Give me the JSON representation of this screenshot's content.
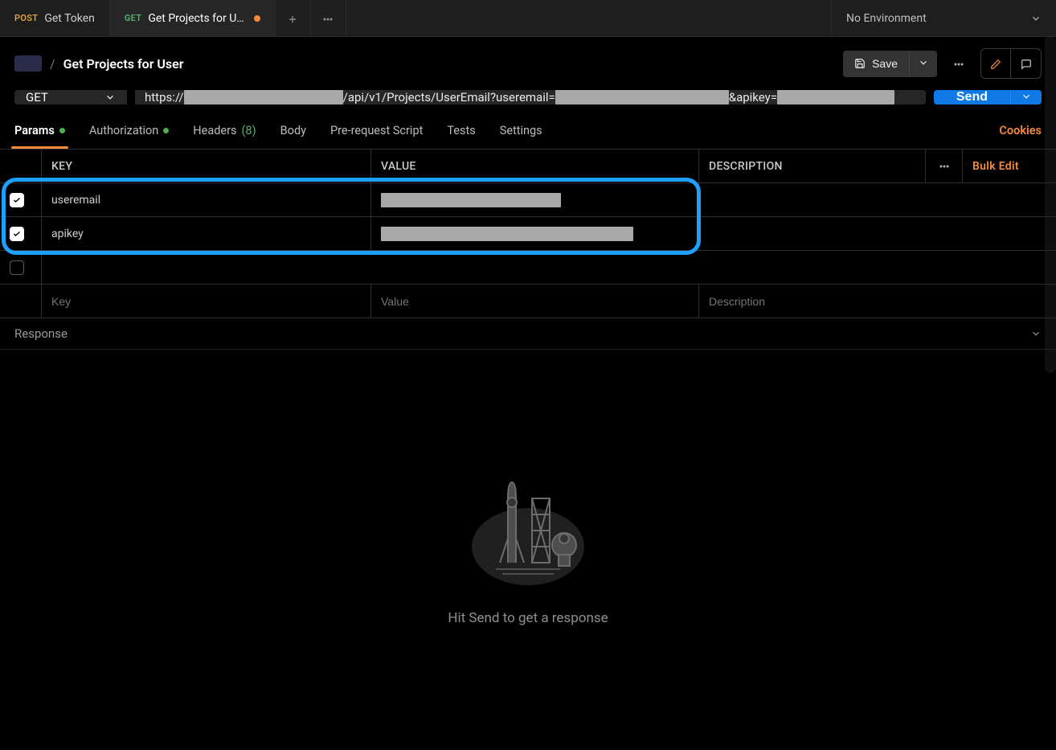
{
  "tabs": [
    {
      "method": "POST",
      "method_class": "method-post",
      "title": "Get Token",
      "active": false,
      "unsaved": false
    },
    {
      "method": "GET",
      "method_class": "method-get",
      "title": "Get Projects for U…",
      "active": true,
      "unsaved": true
    }
  ],
  "environment": {
    "label": "No Environment"
  },
  "breadcrumb": {
    "title": "Get Projects for User",
    "separator": "/"
  },
  "actions": {
    "save_label": "Save"
  },
  "request": {
    "method": "GET",
    "url_parts": {
      "p1": "https://",
      "p2": "/api/v1/Projects/UserEmail?useremail=",
      "p3": "&apikey="
    },
    "send_label": "Send"
  },
  "req_tabs": {
    "params": "Params",
    "auth": "Authorization",
    "headers": "Headers",
    "headers_count": "(8)",
    "body": "Body",
    "prescript": "Pre-request Script",
    "tests": "Tests",
    "settings": "Settings",
    "cookies": "Cookies"
  },
  "params_table": {
    "columns": {
      "key": "KEY",
      "value": "VALUE",
      "desc": "DESCRIPTION",
      "bulk": "Bulk Edit"
    },
    "rows": [
      {
        "checked": true,
        "key": "useremail",
        "value_redact_width": 224
      },
      {
        "checked": true,
        "key": "apikey",
        "value_redact_width": 314
      }
    ],
    "placeholders": {
      "key": "Key",
      "value": "Value",
      "desc": "Description"
    }
  },
  "response": {
    "header": "Response",
    "empty_hint": "Hit Send to get a response"
  }
}
